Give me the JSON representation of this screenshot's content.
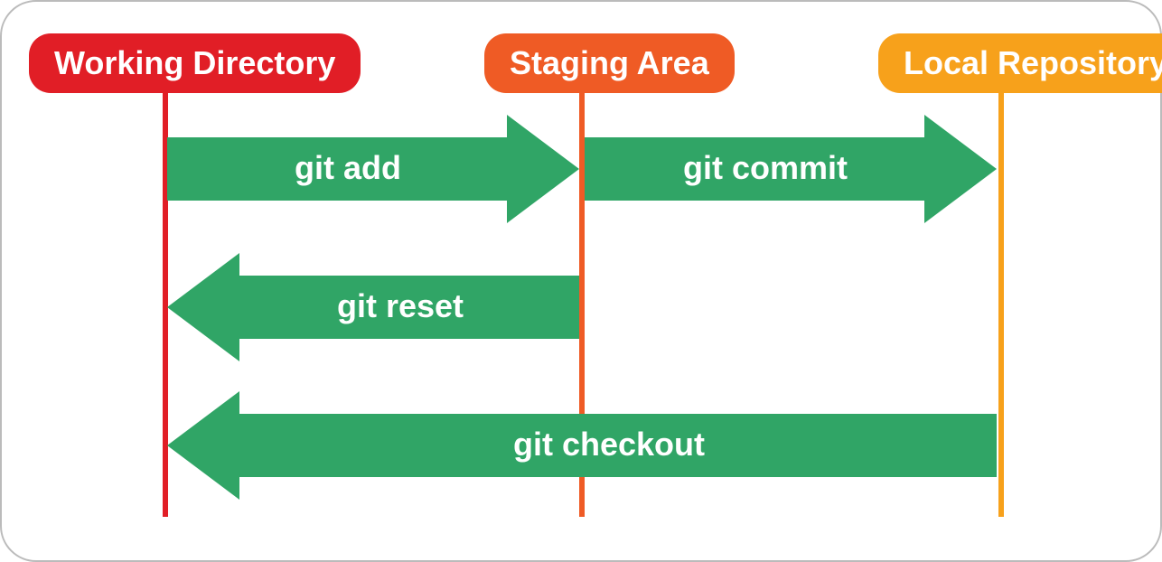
{
  "stages": {
    "working_dir": {
      "label": "Working Directory",
      "color": "#e11e26"
    },
    "staging": {
      "label": "Staging Area",
      "color": "#ef5b25"
    },
    "local_repo": {
      "label": "Local Repository",
      "color": "#f7a11b"
    }
  },
  "arrows": {
    "add": {
      "label": "git add",
      "color": "#30a566"
    },
    "commit": {
      "label": "git commit",
      "color": "#30a566"
    },
    "reset": {
      "label": "git reset",
      "color": "#30a566"
    },
    "checkout": {
      "label": "git checkout",
      "color": "#30a566"
    }
  }
}
